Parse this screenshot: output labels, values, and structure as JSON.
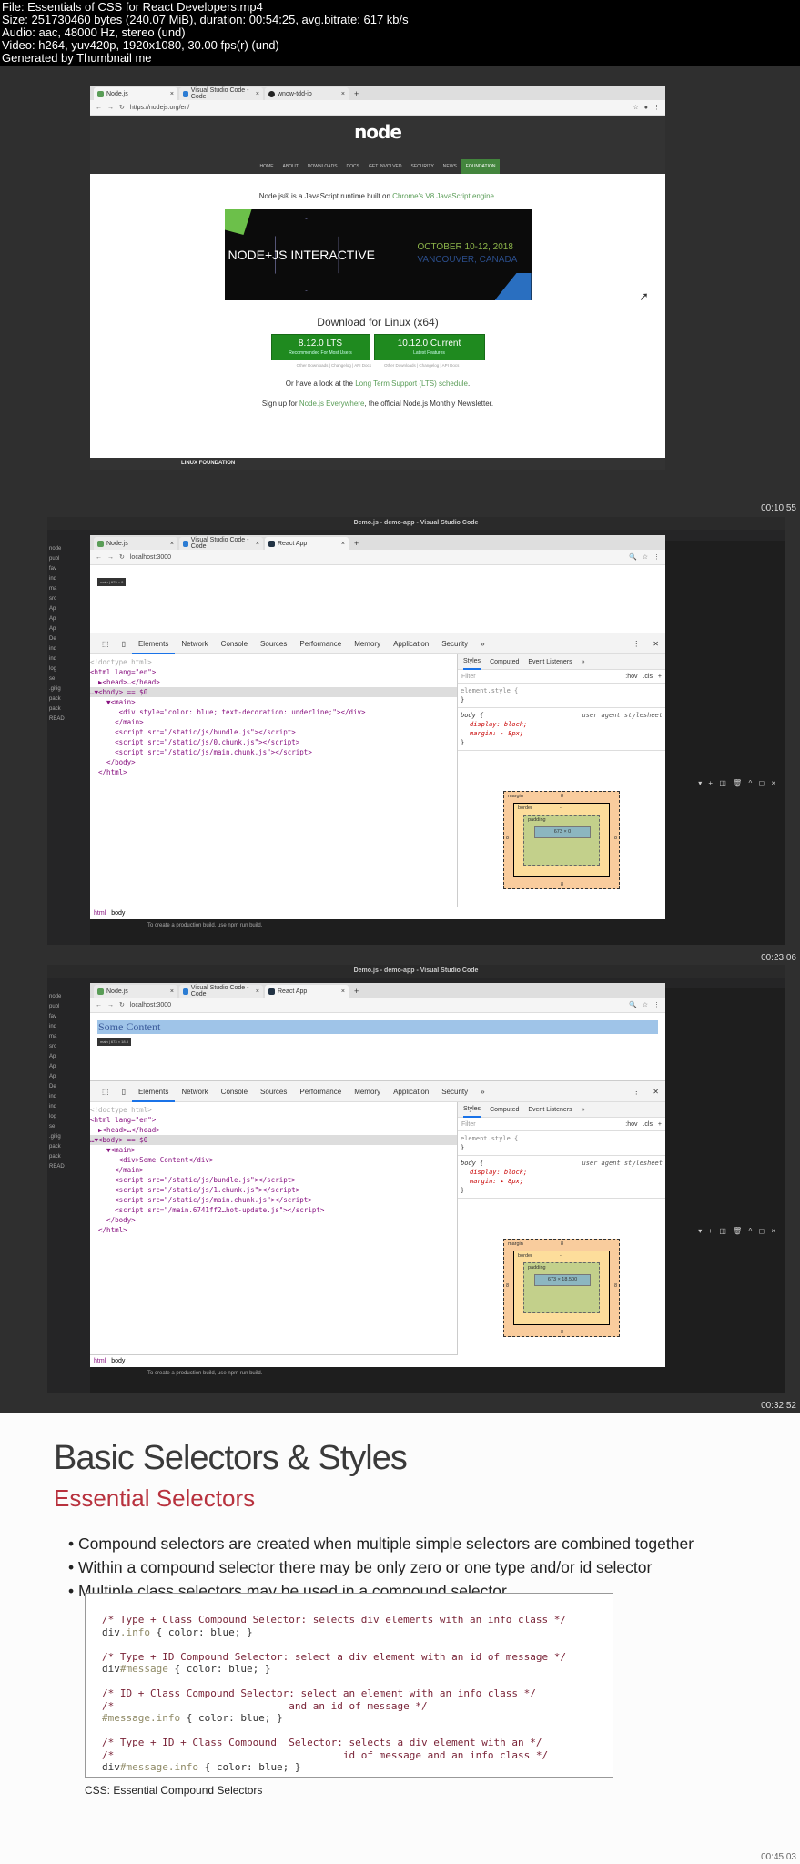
{
  "header": {
    "lines": [
      "File: Essentials of CSS for React Developers.mp4",
      "Size: 251730460 bytes (240.07 MiB), duration: 00:54:25, avg.bitrate: 617 kb/s",
      "Audio: aac, 48000 Hz, stereo (und)",
      "Video: h264, yuv420p, 1920x1080, 30.00 fps(r) (und)",
      "Generated by Thumbnail me"
    ]
  },
  "timestamps": [
    "00:10:55",
    "00:23:06",
    "00:32:52",
    "00:45:03"
  ],
  "frame1": {
    "tabs": [
      "Node.js",
      "Visual Studio Code - Code",
      "wnow-tdd-io"
    ],
    "url": "https://nodejs.org/en/",
    "logo": "node",
    "nav": [
      "HOME",
      "ABOUT",
      "DOWNLOADS",
      "DOCS",
      "GET INVOLVED",
      "SECURITY",
      "NEWS",
      "FOUNDATION"
    ],
    "tagline_pre": "Node.js® is a JavaScript runtime built on ",
    "tagline_link": "Chrome's V8 JavaScript engine",
    ".": ".",
    "banner_title": "NODE+JS INTERACTIVE",
    "banner_date": "OCTOBER 10-12, 2018",
    "banner_place": "VANCOUVER, CANADA",
    "download_heading": "Download for Linux (x64)",
    "lts": {
      "version": "8.12.0 LTS",
      "sub": "Recommended For Most Users"
    },
    "current": {
      "version": "10.12.0 Current",
      "sub": "Latest Features"
    },
    "links": "Other Downloads | Changelog | API Docs",
    "lts_pre": "Or have a look at the ",
    "lts_link": "Long Term Support (LTS) schedule",
    "signup_pre": "Sign up for ",
    "signup_link": "Node.js Everywhere",
    "signup_post": ", the official Node.js Monthly Newsletter.",
    "footer": "LINUX FOUNDATION"
  },
  "vscode": {
    "title": "Demo.js - demo-app - Visual Studio Code",
    "explorer": [
      "node",
      "publ",
      "fav",
      "ind",
      "ma",
      "src",
      "Ap",
      "Ap",
      "Ap",
      "De",
      "ind",
      "ind",
      "log",
      "se",
      ".gitig",
      "pack",
      "pack",
      "READ"
    ],
    "terminal": "To create a production build, use npm run build."
  },
  "browser2": {
    "tabs": [
      "Node.js",
      "Visual Studio Code - Code",
      "React App"
    ],
    "url": "localhost:3000"
  },
  "devtools": {
    "tabs": [
      "Elements",
      "Network",
      "Console",
      "Sources",
      "Performance",
      "Memory",
      "Application",
      "Security",
      "»"
    ],
    "styles_tabs": [
      "Styles",
      "Computed",
      "Event Listeners",
      "»"
    ],
    "filter": "Filter",
    "filter_btns": ":hov .cls +",
    "element_style": "element.style {",
    "close_brace": "}",
    "body_rule": "body {",
    "ua": "user agent stylesheet",
    "display": "display: block;",
    "margin": "margin: ▸ 8px;",
    "box": {
      "margin": "margin",
      "border": "border",
      "padding": "padding",
      "m": "8",
      "dash": "-"
    },
    "crumbs": [
      "html",
      "body"
    ]
  },
  "frame2": {
    "tooltip": "main | 673 × 0",
    "content_size": "673 × 0",
    "dom": [
      "<!doctype html>",
      "<html lang=\"en\">",
      "  ▶<head>…</head>",
      "…▼<body> == $0",
      "    ▼<main>",
      "       <div style=\"color: blue; text-decoration: underline;\"></div>",
      "      </main>",
      "      <script src=\"/static/js/bundle.js\"></script>",
      "      <script src=\"/static/js/0.chunk.js\"></script>",
      "      <script src=\"/static/js/main.chunk.js\"></script>",
      "    </body>",
      "  </html>"
    ]
  },
  "frame3": {
    "page_text": "Some Content",
    "tooltip": "main | 673 × 18.5",
    "content_size": "673 × 18.500",
    "dom": [
      "<!doctype html>",
      "<html lang=\"en\">",
      "  ▶<head>…</head>",
      "…▼<body> == $0",
      "    ▼<main>",
      "       <div>Some Content</div>",
      "      </main>",
      "      <script src=\"/static/js/bundle.js\"></script>",
      "      <script src=\"/static/js/1.chunk.js\"></script>",
      "      <script src=\"/static/js/main.chunk.js\"></script>",
      "      <script src=\"/main.6741ff2…hot-update.js\"></script>",
      "    </body>",
      "  </html>"
    ]
  },
  "slide": {
    "title": "Basic Selectors & Styles",
    "subtitle": "Essential Selectors",
    "bullets": [
      "Compound selectors are created when multiple simple selectors are combined together",
      "Within a compound selector there may be only zero or one type and/or id selector",
      "Multiple class selectors may be used in a compound selector"
    ],
    "code": [
      [
        [
          "/* Type + Class Compound Selector: selects div elements with an info class */",
          "com"
        ]
      ],
      [
        [
          "div",
          "tag"
        ],
        [
          ".info",
          "sel"
        ],
        [
          " { color: blue; }",
          "tag"
        ]
      ],
      [],
      [
        [
          "/* Type + ID Compound Selector: select a div element with an id of message */",
          "com"
        ]
      ],
      [
        [
          "div",
          "tag"
        ],
        [
          "#message",
          "sel"
        ],
        [
          " { color: blue; }",
          "tag"
        ]
      ],
      [],
      [
        [
          "/* ID + Class Compound Selector: select an element with an info class */",
          "com"
        ]
      ],
      [
        [
          "/*                             and an id of message */",
          "com"
        ]
      ],
      [
        [
          "#message.info",
          "sel"
        ],
        [
          " { color: blue; }",
          "tag"
        ]
      ],
      [],
      [
        [
          "/* Type + ID + Class Compound  Selector: selects a div element with an */",
          "com"
        ]
      ],
      [
        [
          "/*                                      id of message and an info class */",
          "com"
        ]
      ],
      [
        [
          "div",
          "tag"
        ],
        [
          "#message.info",
          "sel"
        ],
        [
          " { color: blue; }",
          "tag"
        ]
      ]
    ],
    "caption": "CSS: Essential Compound Selectors"
  }
}
